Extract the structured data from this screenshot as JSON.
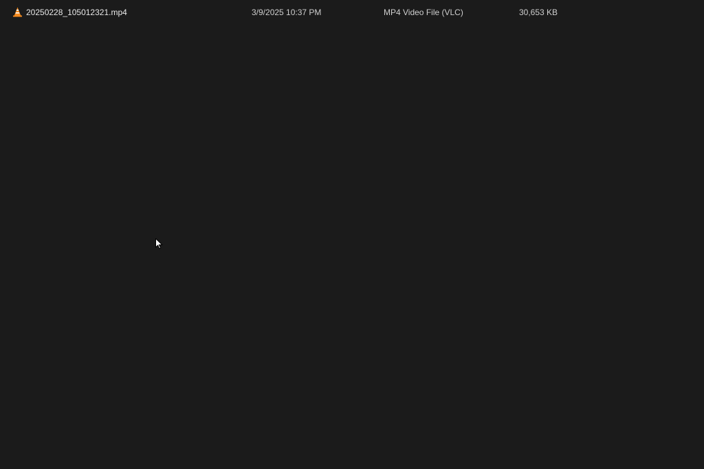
{
  "file_list": {
    "rows": [
      {
        "icon": "vlc-cone-icon",
        "name": "20250228_105012321.mp4",
        "date_modified": "3/9/2025 10:37 PM",
        "type": "MP4 Video File (VLC)",
        "size": "30,653 KB"
      }
    ]
  },
  "colors": {
    "background": "#1b1b1b",
    "text": "#e8e8e8",
    "vlc_orange": "#f58b1f"
  }
}
